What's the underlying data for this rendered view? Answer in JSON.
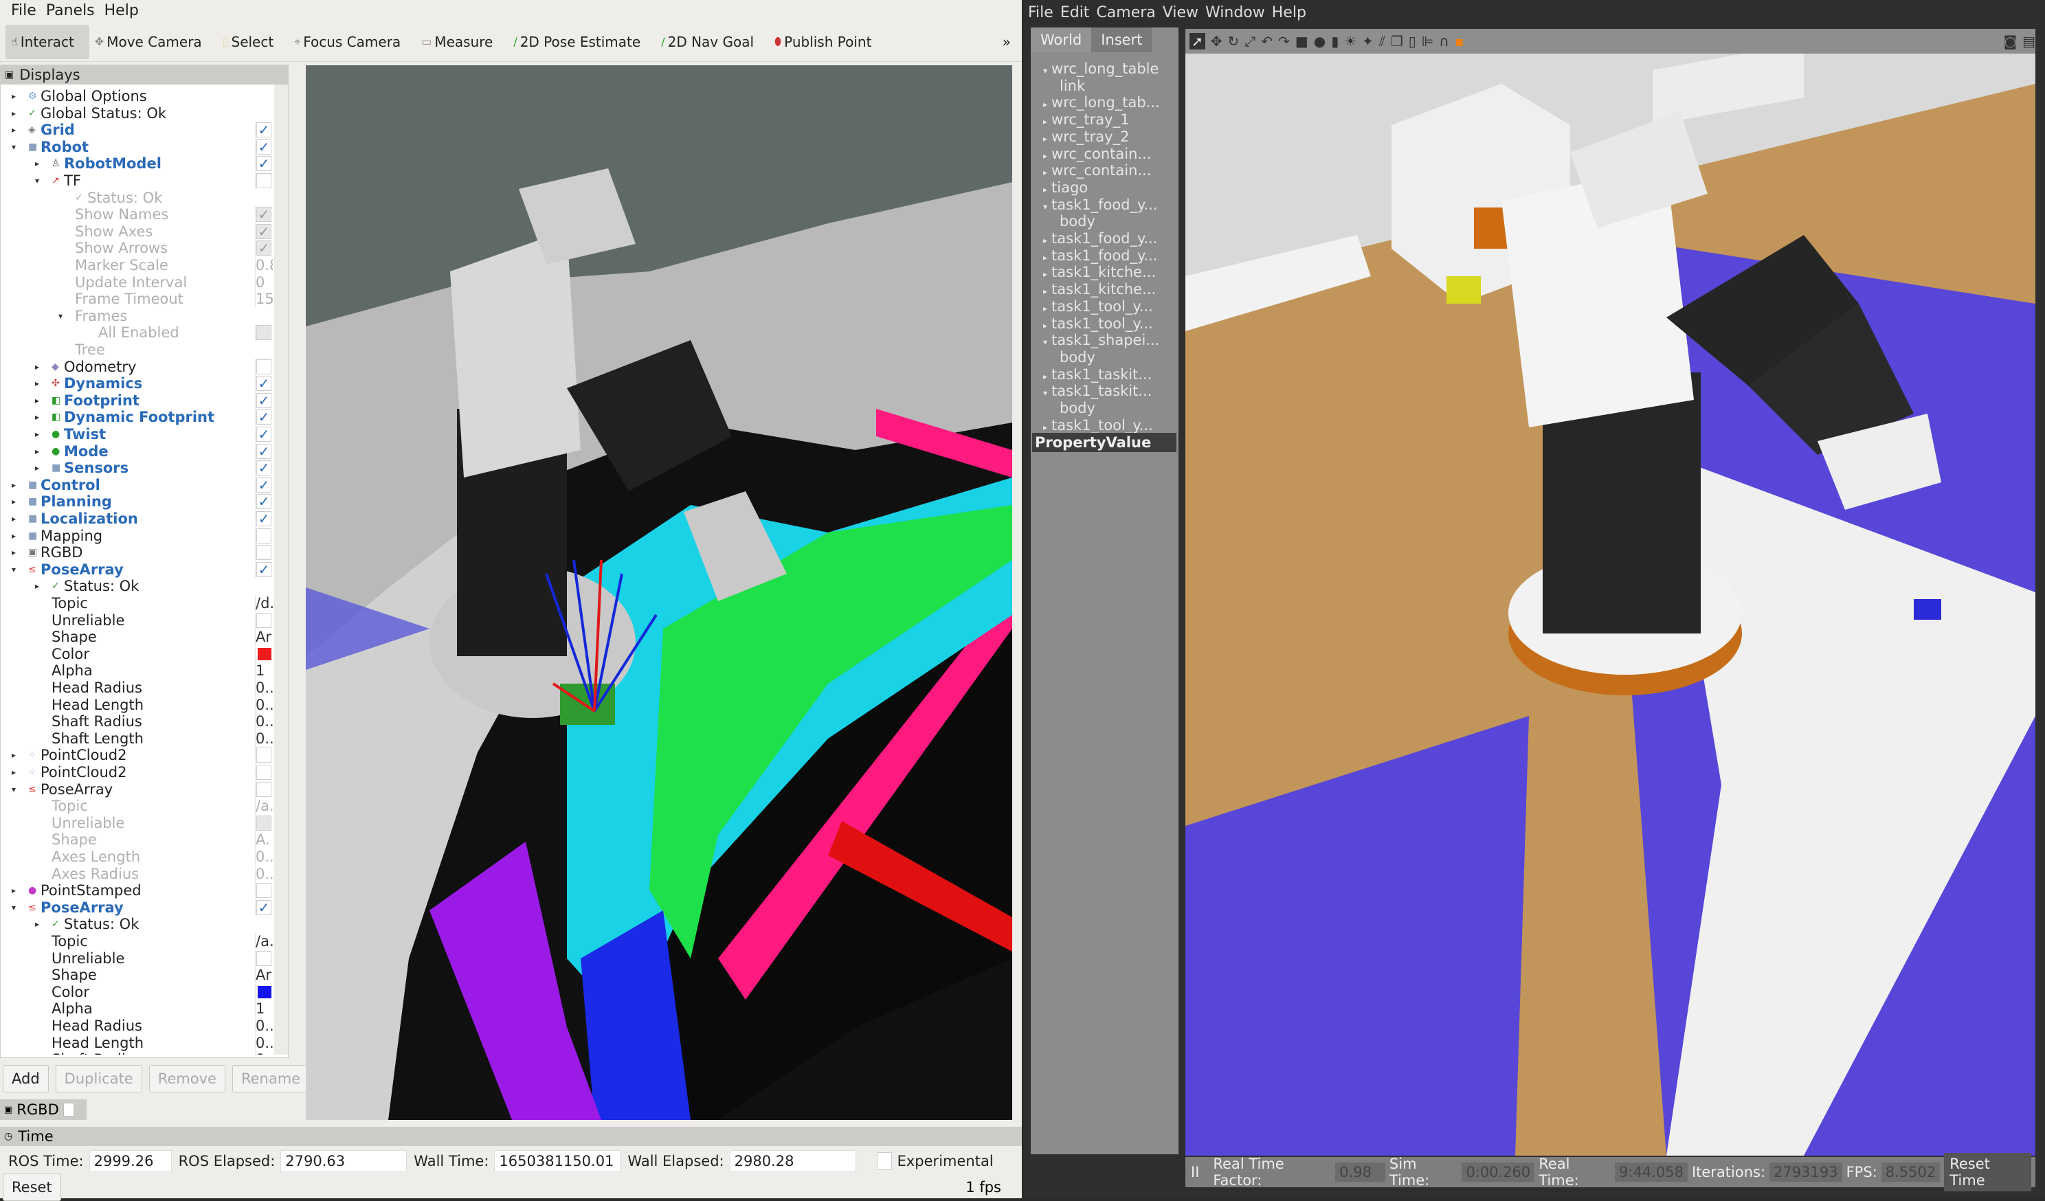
{
  "rviz": {
    "menu": [
      "File",
      "Panels",
      "Help"
    ],
    "tools": [
      {
        "label": "Interact",
        "icon": "hand-icon",
        "active": true
      },
      {
        "label": "Move Camera",
        "icon": "move-icon"
      },
      {
        "label": "Select",
        "icon": "select-icon"
      },
      {
        "label": "Focus Camera",
        "icon": "focus-icon"
      },
      {
        "label": "Measure",
        "icon": "ruler-icon"
      },
      {
        "label": "2D Pose Estimate",
        "icon": "green-arrow-icon"
      },
      {
        "label": "2D Nav Goal",
        "icon": "green-arrow-icon"
      },
      {
        "label": "Publish Point",
        "icon": "pin-icon"
      }
    ],
    "toolbar_more": "»",
    "displays_title": "Displays",
    "tree": [
      {
        "label": "Global Options",
        "indent": 0,
        "arrow": "▸",
        "icon": "⚙",
        "iconColor": "#7a9ad8"
      },
      {
        "label": "Global Status: Ok",
        "indent": 0,
        "arrow": "▸",
        "icon": "✓",
        "iconColor": "#3a9a3a"
      },
      {
        "label": "Grid",
        "indent": 0,
        "arrow": "▸",
        "icon": "◈",
        "iconColor": "#777",
        "style": "bold",
        "check": true
      },
      {
        "label": "Robot",
        "indent": 0,
        "arrow": "▾",
        "icon": "■",
        "iconColor": "#8aa0c0",
        "style": "bold",
        "check": true
      },
      {
        "label": "RobotModel",
        "indent": 1,
        "arrow": "▸",
        "icon": "♙",
        "iconColor": "#555",
        "style": "bold",
        "check": true
      },
      {
        "label": "TF",
        "indent": 1,
        "arrow": "▾",
        "icon": "↗",
        "iconColor": "#c33",
        "check": false
      },
      {
        "label": "Status: Ok",
        "indent": 2,
        "style": "dis",
        "icon": "✓",
        "iconColor": "#aaa"
      },
      {
        "label": "Show Names",
        "indent": 2,
        "style": "dis",
        "check": true
      },
      {
        "label": "Show Axes",
        "indent": 2,
        "style": "dis",
        "check": true
      },
      {
        "label": "Show Arrows",
        "indent": 2,
        "style": "dis",
        "check": true
      },
      {
        "label": "Marker Scale",
        "indent": 2,
        "style": "dis",
        "value": "0.8"
      },
      {
        "label": "Update Interval",
        "indent": 2,
        "style": "dis",
        "value": "0"
      },
      {
        "label": "Frame Timeout",
        "indent": 2,
        "style": "dis",
        "value": "15"
      },
      {
        "label": "Frames",
        "indent": 2,
        "arrow": "▾",
        "style": "dis"
      },
      {
        "label": "All Enabled",
        "indent": 3,
        "style": "dis",
        "check": false
      },
      {
        "label": "Tree",
        "indent": 2,
        "style": "dis"
      },
      {
        "label": "Odometry",
        "indent": 1,
        "arrow": "▸",
        "icon": "◆",
        "iconColor": "#8a8ac0",
        "check": false
      },
      {
        "label": "Dynamics",
        "indent": 1,
        "arrow": "▸",
        "icon": "✣",
        "iconColor": "#c33",
        "style": "bold",
        "check": true
      },
      {
        "label": "Footprint",
        "indent": 1,
        "arrow": "▸",
        "icon": "◧",
        "iconColor": "#2a9a2a",
        "style": "bold",
        "check": true
      },
      {
        "label": "Dynamic Footprint",
        "indent": 1,
        "arrow": "▸",
        "icon": "◧",
        "iconColor": "#2a9a2a",
        "style": "bold",
        "check": true
      },
      {
        "label": "Twist",
        "indent": 1,
        "arrow": "▸",
        "icon": "●",
        "iconColor": "#2aa02a",
        "style": "bold",
        "check": true
      },
      {
        "label": "Mode",
        "indent": 1,
        "arrow": "▸",
        "icon": "●",
        "iconColor": "#2aa02a",
        "style": "bold",
        "check": true
      },
      {
        "label": "Sensors",
        "indent": 1,
        "arrow": "▸",
        "icon": "■",
        "iconColor": "#8aa0c0",
        "style": "bold",
        "check": true
      },
      {
        "label": "Control",
        "indent": 0,
        "arrow": "▸",
        "icon": "■",
        "iconColor": "#8aa0c0",
        "style": "bold",
        "check": true
      },
      {
        "label": "Planning",
        "indent": 0,
        "arrow": "▸",
        "icon": "■",
        "iconColor": "#8aa0c0",
        "style": "bold",
        "check": true
      },
      {
        "label": "Localization",
        "indent": 0,
        "arrow": "▸",
        "icon": "■",
        "iconColor": "#8aa0c0",
        "style": "bold",
        "check": true
      },
      {
        "label": "Mapping",
        "indent": 0,
        "arrow": "▸",
        "icon": "■",
        "iconColor": "#8aa0c0",
        "check": false
      },
      {
        "label": "RGBD",
        "indent": 0,
        "arrow": "▸",
        "icon": "▣",
        "iconColor": "#777",
        "check": false
      },
      {
        "label": "PoseArray",
        "indent": 0,
        "arrow": "▾",
        "icon": "≤",
        "iconColor": "#d33",
        "style": "bold",
        "check": true
      },
      {
        "label": "Status: Ok",
        "indent": 1,
        "arrow": "▸",
        "icon": "✓",
        "iconColor": "#3a9a3a"
      },
      {
        "label": "Topic",
        "indent": 1,
        "value": "/d."
      },
      {
        "label": "Unreliable",
        "indent": 1,
        "check": false
      },
      {
        "label": "Shape",
        "indent": 1,
        "value": "Ar"
      },
      {
        "label": "Color",
        "indent": 1,
        "color": "#ee1c1c"
      },
      {
        "label": "Alpha",
        "indent": 1,
        "value": "1"
      },
      {
        "label": "Head Radius",
        "indent": 1,
        "value": "0.."
      },
      {
        "label": "Head Length",
        "indent": 1,
        "value": "0.."
      },
      {
        "label": "Shaft Radius",
        "indent": 1,
        "value": "0.."
      },
      {
        "label": "Shaft Length",
        "indent": 1,
        "value": "0.."
      },
      {
        "label": "PointCloud2",
        "indent": 0,
        "arrow": "▸",
        "icon": "⁘",
        "iconColor": "#6a9ad8",
        "check": false
      },
      {
        "label": "PointCloud2",
        "indent": 0,
        "arrow": "▸",
        "icon": "⁘",
        "iconColor": "#6a9ad8",
        "check": false
      },
      {
        "label": "PoseArray",
        "indent": 0,
        "arrow": "▾",
        "icon": "≤",
        "iconColor": "#d33",
        "check": false
      },
      {
        "label": "Topic",
        "indent": 1,
        "style": "dis",
        "value": "/a."
      },
      {
        "label": "Unreliable",
        "indent": 1,
        "style": "dis",
        "check": false
      },
      {
        "label": "Shape",
        "indent": 1,
        "style": "dis",
        "value": "A."
      },
      {
        "label": "Axes Length",
        "indent": 1,
        "style": "dis",
        "value": "0.."
      },
      {
        "label": "Axes Radius",
        "indent": 1,
        "style": "dis",
        "value": "0.."
      },
      {
        "label": "PointStamped",
        "indent": 0,
        "arrow": "▸",
        "icon": "●",
        "iconColor": "#c23ac8",
        "check": false
      },
      {
        "label": "PoseArray",
        "indent": 0,
        "arrow": "▾",
        "icon": "≤",
        "iconColor": "#d33",
        "style": "bold",
        "check": true
      },
      {
        "label": "Status: Ok",
        "indent": 1,
        "arrow": "▸",
        "icon": "✓",
        "iconColor": "#3a9a3a"
      },
      {
        "label": "Topic",
        "indent": 1,
        "value": "/a."
      },
      {
        "label": "Unreliable",
        "indent": 1,
        "check": false
      },
      {
        "label": "Shape",
        "indent": 1,
        "value": "Ar"
      },
      {
        "label": "Color",
        "indent": 1,
        "color": "#1414ee"
      },
      {
        "label": "Alpha",
        "indent": 1,
        "value": "1"
      },
      {
        "label": "Head Radius",
        "indent": 1,
        "value": "0.."
      },
      {
        "label": "Head Length",
        "indent": 1,
        "value": "0.."
      },
      {
        "label": "Shaft Radius",
        "indent": 1,
        "value": "0.."
      }
    ],
    "buttons": {
      "add": "Add",
      "duplicate": "Duplicate",
      "remove": "Remove",
      "rename": "Rename"
    },
    "rgbd_panel": "RGBD",
    "time": {
      "title": "Time",
      "ros_time_label": "ROS Time:",
      "ros_time": "2999.26",
      "ros_elapsed_label": "ROS Elapsed:",
      "ros_elapsed": "2790.63",
      "wall_time_label": "Wall Time:",
      "wall_time": "1650381150.01",
      "wall_elapsed_label": "Wall Elapsed:",
      "wall_elapsed": "2980.28",
      "experimental": "Experimental",
      "reset": "Reset",
      "fps": "1 fps"
    }
  },
  "gazebo": {
    "menu": [
      "File",
      "Edit",
      "Camera",
      "View",
      "Window",
      "Help"
    ],
    "tabs": [
      "World",
      "Insert"
    ],
    "tree": [
      {
        "label": "wrc_long_table",
        "arrow": "▾",
        "indent": 0
      },
      {
        "label": "link",
        "indent": 1
      },
      {
        "label": "wrc_long_tab...",
        "arrow": "▸",
        "indent": 0
      },
      {
        "label": "wrc_tray_1",
        "arrow": "▸",
        "indent": 0
      },
      {
        "label": "wrc_tray_2",
        "arrow": "▸",
        "indent": 0
      },
      {
        "label": "wrc_contain...",
        "arrow": "▸",
        "indent": 0
      },
      {
        "label": "wrc_contain...",
        "arrow": "▸",
        "indent": 0
      },
      {
        "label": "tiago",
        "arrow": "▸",
        "indent": 0
      },
      {
        "label": "task1_food_y...",
        "arrow": "▾",
        "indent": 0
      },
      {
        "label": "body",
        "indent": 1
      },
      {
        "label": "task1_food_y...",
        "arrow": "▸",
        "indent": 0
      },
      {
        "label": "task1_food_y...",
        "arrow": "▸",
        "indent": 0
      },
      {
        "label": "task1_kitche...",
        "arrow": "▸",
        "indent": 0
      },
      {
        "label": "task1_kitche...",
        "arrow": "▸",
        "indent": 0
      },
      {
        "label": "task1_tool_y...",
        "arrow": "▸",
        "indent": 0
      },
      {
        "label": "task1_tool_y...",
        "arrow": "▸",
        "indent": 0
      },
      {
        "label": "task1_shapei...",
        "arrow": "▾",
        "indent": 0
      },
      {
        "label": "body",
        "indent": 1
      },
      {
        "label": "task1_taskit...",
        "arrow": "▸",
        "indent": 0
      },
      {
        "label": "task1_taskit...",
        "arrow": "▾",
        "indent": 0
      },
      {
        "label": "body",
        "indent": 1
      },
      {
        "label": "task1_tool_y...",
        "arrow": "▸",
        "indent": 0
      }
    ],
    "property_header": "PropertyValue",
    "toolbar_icons": [
      "select-arrow-icon",
      "translate-icon",
      "rotate-icon",
      "scale-icon",
      "undo-icon",
      "redo-icon",
      "box-icon",
      "sphere-icon",
      "cylinder-icon",
      "sun-light-icon",
      "point-light-icon",
      "spot-light-icon",
      "copy-icon",
      "paste-icon",
      "align-icon",
      "snap-icon",
      "orange-view-icon",
      "screenshot-icon",
      "record-icon"
    ],
    "status": {
      "pause": "II",
      "rtf_label": "Real Time Factor:",
      "rtf": "0.98",
      "sim_time_label": "Sim Time:",
      "sim_time": "0:00.260",
      "real_time_label": "Real Time:",
      "real_time": "9:44.058",
      "iterations_label": "Iterations:",
      "iterations": "2793193",
      "fps_label": "FPS:",
      "fps": "8.5502",
      "reset_time": "Reset Time"
    }
  }
}
